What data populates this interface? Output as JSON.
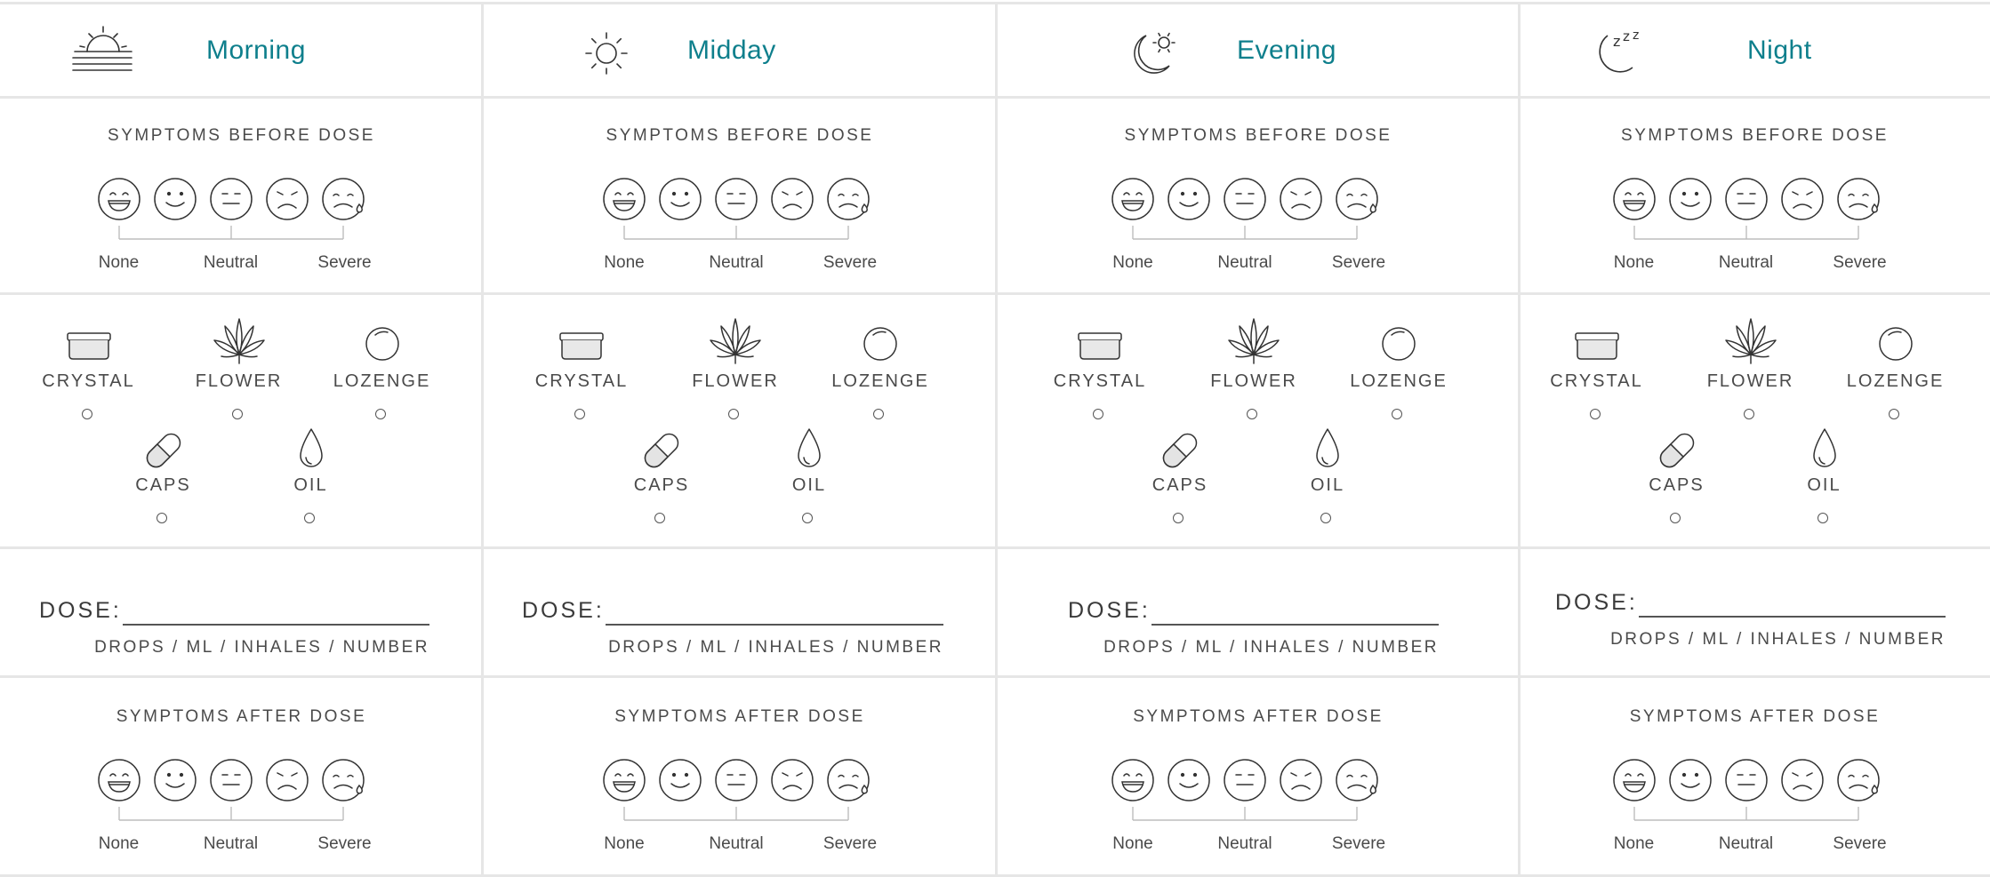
{
  "columns": [
    {
      "title": "Morning",
      "icon": "sunrise-icon",
      "before_label": "SYMPTOMS BEFORE DOSE",
      "after_label": "SYMPTOMS AFTER DOSE",
      "scale": {
        "none": "None",
        "neutral": "Neutral",
        "severe": "Severe"
      },
      "forms": {
        "crystal": "CRYSTAL",
        "flower": "FLOWER",
        "lozenge": "LOZENGE",
        "caps": "CAPS",
        "oil": "OIL"
      },
      "dose_label": "DOSE:",
      "dose_units": "DROPS / ML / INHALES / NUMBER"
    },
    {
      "title": "Midday",
      "icon": "sun-icon",
      "before_label": "SYMPTOMS BEFORE DOSE",
      "after_label": "SYMPTOMS AFTER DOSE",
      "scale": {
        "none": "None",
        "neutral": "Neutral",
        "severe": "Severe"
      },
      "forms": {
        "crystal": "CRYSTAL",
        "flower": "FLOWER",
        "lozenge": "LOZENGE",
        "caps": "CAPS",
        "oil": "OIL"
      },
      "dose_label": "DOSE:",
      "dose_units": "DROPS / ML / INHALES / NUMBER"
    },
    {
      "title": "Evening",
      "icon": "moon-sun-icon",
      "before_label": "SYMPTOMS BEFORE DOSE",
      "after_label": "SYMPTOMS AFTER DOSE",
      "scale": {
        "none": "None",
        "neutral": "Neutral",
        "severe": "Severe"
      },
      "forms": {
        "crystal": "CRYSTAL",
        "flower": "FLOWER",
        "lozenge": "LOZENGE",
        "caps": "CAPS",
        "oil": "OIL"
      },
      "dose_label": "DOSE:",
      "dose_units": "DROPS / ML / INHALES / NUMBER"
    },
    {
      "title": "Night",
      "icon": "moon-zzz-icon",
      "before_label": "SYMPTOMS BEFORE DOSE",
      "after_label": "SYMPTOMS AFTER DOSE",
      "scale": {
        "none": "None",
        "neutral": "Neutral",
        "severe": "Severe"
      },
      "forms": {
        "crystal": "CRYSTAL",
        "flower": "FLOWER",
        "lozenge": "LOZENGE",
        "caps": "CAPS",
        "oil": "OIL"
      },
      "dose_label": "DOSE:",
      "dose_units": "DROPS / ML / INHALES / NUMBER"
    }
  ],
  "colors": {
    "accent": "#0e7f8c",
    "ink": "#3a3a3a",
    "divider": "#e6e6e6"
  }
}
